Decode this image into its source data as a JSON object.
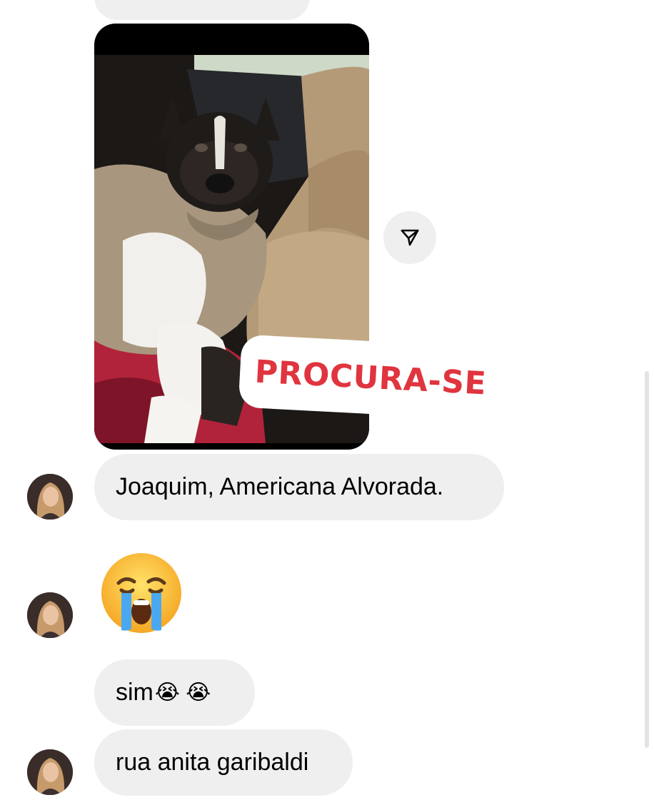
{
  "thread": {
    "story_reply": {
      "sticker_text": "PROCURA-SE"
    },
    "messages": [
      {
        "text": "Joaquim, Americana Alvorada."
      },
      {
        "emoji": "loudly-crying-face"
      },
      {
        "text": "sim"
      },
      {
        "text": "rua anita garibaldi"
      }
    ]
  },
  "colors": {
    "bubble_bg": "#efefef",
    "sticker_text": "#e0343e"
  }
}
